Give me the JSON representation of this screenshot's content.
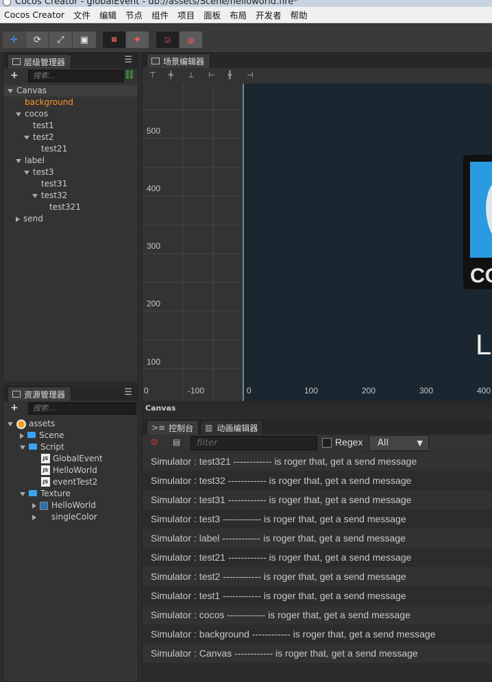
{
  "window": {
    "title": "Cocos Creator - globalEvent - db://assets/Scene/helloworld.fire*"
  },
  "menu": [
    "Cocos Creator",
    "文件",
    "编辑",
    "节点",
    "组件",
    "项目",
    "面板",
    "布局",
    "开发者",
    "帮助"
  ],
  "toolbar": {
    "icons": [
      "move-tool",
      "rotate-tool",
      "scale-tool",
      "rect-tool",
      "anchor-pivot",
      "coordinate-local",
      "preview-2d",
      "preview-3d"
    ]
  },
  "hierarchy": {
    "title": "层级管理器",
    "search_placeholder": "搜索...",
    "nodes": [
      {
        "label": "Canvas",
        "depth": 0,
        "expand": "down",
        "highlight": true
      },
      {
        "label": "background",
        "depth": 1,
        "expand": "",
        "selected": true
      },
      {
        "label": "cocos",
        "depth": 1,
        "expand": "down"
      },
      {
        "label": "test1",
        "depth": 2,
        "expand": ""
      },
      {
        "label": "test2",
        "depth": 2,
        "expand": "down"
      },
      {
        "label": "test21",
        "depth": 3,
        "expand": ""
      },
      {
        "label": "label",
        "depth": 1,
        "expand": "down"
      },
      {
        "label": "test3",
        "depth": 2,
        "expand": "down"
      },
      {
        "label": "test31",
        "depth": 3,
        "expand": ""
      },
      {
        "label": "test32",
        "depth": 3,
        "expand": "down"
      },
      {
        "label": "test321",
        "depth": 4,
        "expand": ""
      },
      {
        "label": "send",
        "depth": 1,
        "expand": "right"
      }
    ]
  },
  "assets": {
    "title": "资源管理器",
    "search_placeholder": "搜索...",
    "items": [
      {
        "label": "assets",
        "depth": 0,
        "expand": "down",
        "kind": "db"
      },
      {
        "label": "Scene",
        "depth": 1,
        "expand": "right",
        "kind": "folder"
      },
      {
        "label": "Script",
        "depth": 1,
        "expand": "down",
        "kind": "folder"
      },
      {
        "label": "GlobalEvent",
        "depth": 2,
        "expand": "",
        "kind": "js"
      },
      {
        "label": "HelloWorld",
        "depth": 2,
        "expand": "",
        "kind": "js"
      },
      {
        "label": "eventTest2",
        "depth": 2,
        "expand": "",
        "kind": "js"
      },
      {
        "label": "Texture",
        "depth": 1,
        "expand": "down",
        "kind": "folder"
      },
      {
        "label": "HelloWorld",
        "depth": 2,
        "expand": "right",
        "kind": "image"
      },
      {
        "label": "singleColor",
        "depth": 2,
        "expand": "right",
        "kind": "blank"
      }
    ]
  },
  "scene": {
    "title": "场景编辑器",
    "ruler_y": [
      "500",
      "400",
      "300",
      "200",
      "100"
    ],
    "ruler_x": [
      "0",
      "-100",
      "0",
      "100",
      "200",
      "300",
      "400"
    ],
    "footer": "Canvas",
    "canvas_text": [
      "COCOS",
      "L"
    ]
  },
  "console": {
    "tab_console": "控制台",
    "tab_animation": "动画编辑器",
    "filter_placeholder": "filter",
    "regex_label": "Regex",
    "level_select": "All",
    "rows": [
      "Simulator : test321 ------------ is roger that, get a send message",
      "Simulator : test32 ------------ is roger that, get a send message",
      "Simulator : test31 ------------ is roger that, get a send message",
      "Simulator : test3 ------------ is roger that, get a send message",
      "Simulator : label ------------ is roger that, get a send message",
      "Simulator : test21 ------------ is roger that, get a send message",
      "Simulator : test2 ------------ is roger that, get a send message",
      "Simulator : test1 ------------ is roger that, get a send message",
      "Simulator : cocos ------------ is roger that, get a send message",
      "Simulator : background ------------ is roger that, get a send message",
      "Simulator : Canvas ------------ is roger that, get a send message"
    ]
  },
  "colors": {
    "selected_node": "#fd942b",
    "accent_blue": "#39a0ff",
    "folder_blue": "#3aa4f4",
    "link_green": "#3fd23f",
    "scene_bg": "#1a2630"
  }
}
